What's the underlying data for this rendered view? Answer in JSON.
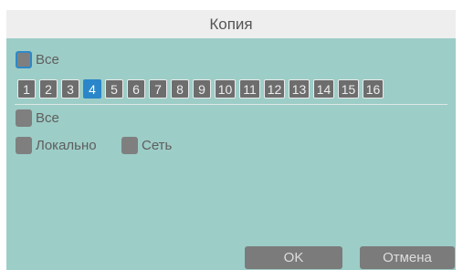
{
  "dialog": {
    "title": "Копия"
  },
  "channels_all": {
    "label": "Все",
    "checked": false
  },
  "channels": [
    {
      "label": "1",
      "selected": false
    },
    {
      "label": "2",
      "selected": false
    },
    {
      "label": "3",
      "selected": false
    },
    {
      "label": "4",
      "selected": true
    },
    {
      "label": "5",
      "selected": false
    },
    {
      "label": "6",
      "selected": false
    },
    {
      "label": "7",
      "selected": false
    },
    {
      "label": "8",
      "selected": false
    },
    {
      "label": "9",
      "selected": false
    },
    {
      "label": "10",
      "selected": false
    },
    {
      "label": "11",
      "selected": false
    },
    {
      "label": "12",
      "selected": false
    },
    {
      "label": "13",
      "selected": false
    },
    {
      "label": "14",
      "selected": false
    },
    {
      "label": "15",
      "selected": false
    },
    {
      "label": "16",
      "selected": false
    }
  ],
  "targets_all": {
    "label": "Все",
    "checked": false
  },
  "local": {
    "label": "Локально",
    "checked": false
  },
  "network": {
    "label": "Сеть",
    "checked": false
  },
  "buttons": {
    "ok": "OK",
    "cancel": "Отмена"
  },
  "colors": {
    "accent": "#2a86c9",
    "background": "#9dcdc7",
    "titlebar": "#eeeeee",
    "button": "#7b7b7b"
  }
}
